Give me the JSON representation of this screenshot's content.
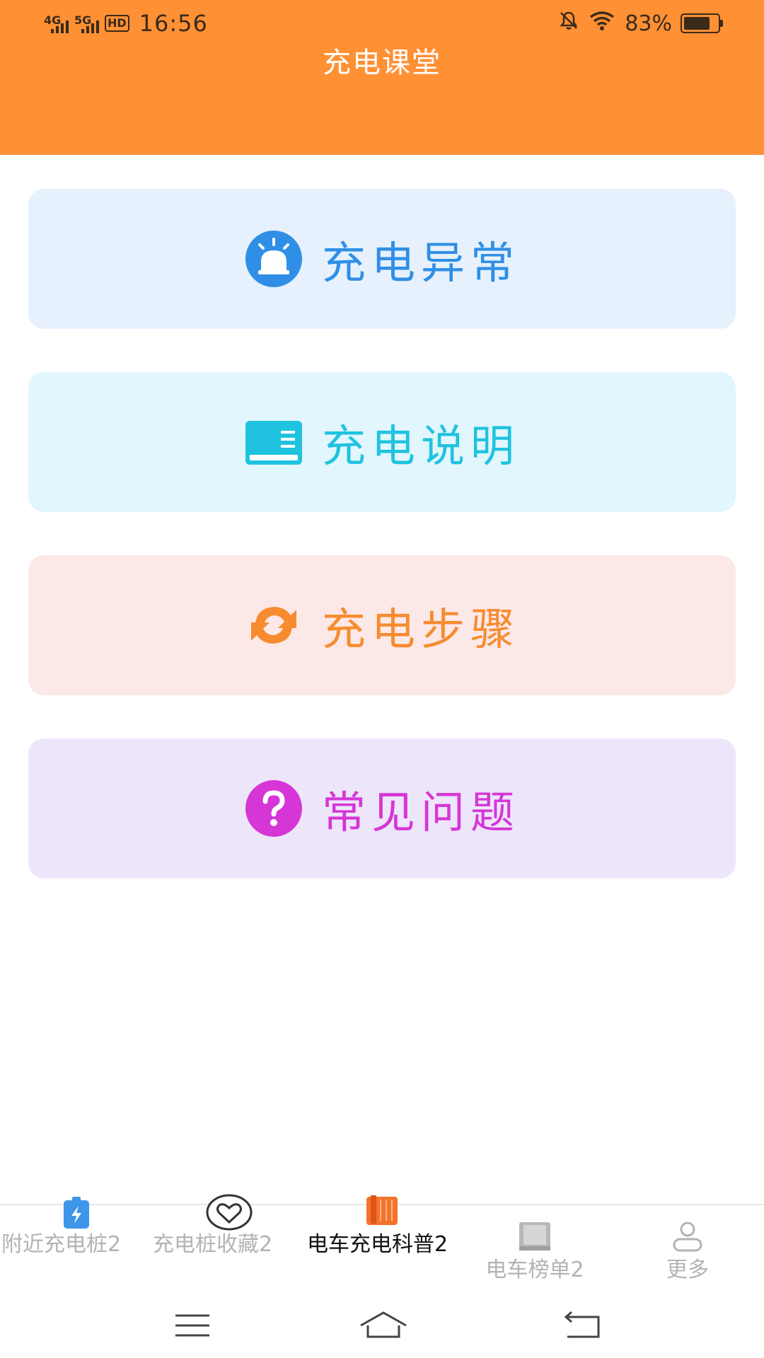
{
  "status_bar": {
    "net1": "4G",
    "net2": "5G",
    "hd": "HD",
    "time": "16:56",
    "battery": "83%"
  },
  "header": {
    "title": "充电课堂"
  },
  "cards": [
    {
      "label": "充电异常",
      "icon": "alarm-icon",
      "bg": "#e6f1fd",
      "color": "#2f8fe6"
    },
    {
      "label": "充电说明",
      "icon": "book-icon",
      "bg": "#e2f6fd",
      "color": "#1fc3e0"
    },
    {
      "label": "充电步骤",
      "icon": "refresh-icon",
      "bg": "#fde8e8",
      "color": "#f68c2f"
    },
    {
      "label": "常见问题",
      "icon": "question-icon",
      "bg": "#ede6fb",
      "color": "#d636d6"
    }
  ],
  "tabs": [
    {
      "label": "附近充电桩2",
      "icon": "charging-battery-icon"
    },
    {
      "label": "充电桩收藏2",
      "icon": "heart-icon"
    },
    {
      "label": "电车充电科普2",
      "icon": "book-stack-icon",
      "active": true
    },
    {
      "label": "电车榜单2",
      "icon": "ranking-book-icon"
    },
    {
      "label": "更多",
      "icon": "user-icon"
    }
  ],
  "colors": {
    "header": "#ff9034",
    "tab_active": "#111111",
    "tab_inactive": "#b3b3b3",
    "active_icon": "#f4732a"
  }
}
